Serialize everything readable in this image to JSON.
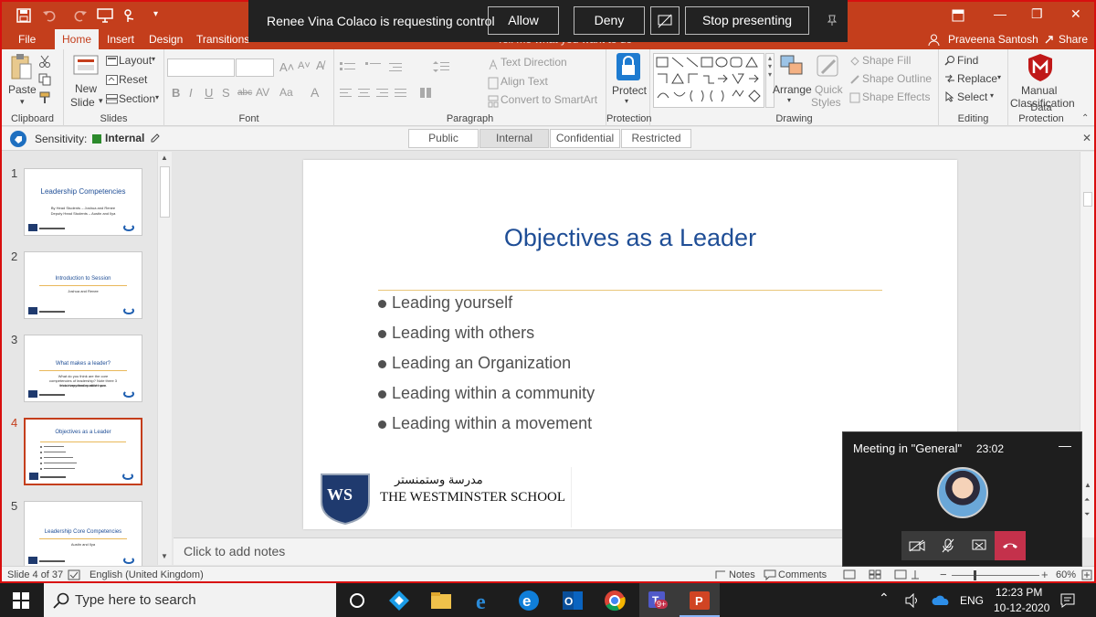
{
  "app": {
    "qat": {
      "save": "save-icon",
      "undo": "undo-icon",
      "redo": "redo-icon",
      "present": "present-icon",
      "touch": "touch-icon",
      "customize": "customize-icon"
    },
    "window_controls": {
      "restore_ribbon": "ribbon-display-icon",
      "minimize": "—",
      "restore": "❐",
      "close": "✕"
    }
  },
  "tabs": [
    "File",
    "Home",
    "Insert",
    "Design",
    "Transitions"
  ],
  "active_tab": "Home",
  "tell_me": "Tell me what you want to do",
  "user": {
    "name": "Praveena Santosh",
    "share": "Share"
  },
  "ribbon": {
    "clipboard": {
      "paste": "Paste",
      "label": "Clipboard"
    },
    "slides": {
      "new_slide_line1": "New",
      "new_slide_line2": "Slide",
      "layout": "Layout",
      "reset": "Reset",
      "section": "Section",
      "label": "Slides"
    },
    "font": {
      "label": "Font",
      "bold": "B",
      "italic": "I",
      "underline": "U",
      "strike": "S",
      "shadow": "abc",
      "spacing": "AV",
      "case": "Aa",
      "color": "A"
    },
    "paragraph": {
      "text_direction": "Text Direction",
      "align_text": "Align Text",
      "smartart": "Convert to SmartArt",
      "label": "Paragraph"
    },
    "protection": {
      "protect": "Protect",
      "label": "Protection"
    },
    "drawing": {
      "arrange": "Arrange",
      "quick_styles_line1": "Quick",
      "quick_styles_line2": "Styles",
      "shape_fill": "Shape Fill",
      "shape_outline": "Shape Outline",
      "shape_effects": "Shape Effects",
      "label": "Drawing"
    },
    "editing": {
      "find": "Find",
      "replace": "Replace",
      "select": "Select",
      "label": "Editing"
    },
    "data_protection": {
      "manual_line1": "Manual",
      "manual_line2": "Classification",
      "label": "Data Protection"
    }
  },
  "sensitivity": {
    "label": "Sensitivity:",
    "value": "Internal",
    "options": [
      "Public",
      "Internal",
      "Confidential",
      "Restricted"
    ],
    "selected": "Internal"
  },
  "thumbnails": [
    {
      "num": "1",
      "title": "Leadership Competencies",
      "sub1": "By Head Students – Joshua and Renee",
      "sub2": "Deputy Head Students – Austin and Ilya"
    },
    {
      "num": "2",
      "title": "Introduction to Session",
      "sub1": "Joshua and Renee",
      "sub2": ""
    },
    {
      "num": "3",
      "title": "What makes a leader?",
      "sub1": "What do you think are the core competencies of leadership? Note three 3 most important qualities you",
      "sub2": "think every leader must have."
    },
    {
      "num": "4",
      "title": "Objectives as a Leader",
      "sub1": "",
      "sub2": ""
    },
    {
      "num": "5",
      "title": "Leadership Core Competencies",
      "sub1": "Austin and Ilya",
      "sub2": ""
    }
  ],
  "slide": {
    "title": "Objectives as a Leader",
    "bullets": [
      "Leading yourself",
      "Leading with others",
      "Leading an Organization",
      "Leading within a community",
      "Leading within a movement"
    ],
    "logo_initials": "WS",
    "logo_arabic": "مدرسة وستمنستر",
    "logo_text": "THE WESTMINSTER SCHOOL"
  },
  "notes_placeholder": "Click to add notes",
  "status": {
    "slide": "Slide 4 of 37",
    "language": "English (United Kingdom)",
    "notes": "Notes",
    "comments": "Comments",
    "zoom": "60%"
  },
  "share_bar": {
    "message": "Renee Vina Colaco is requesting control",
    "allow": "Allow",
    "deny": "Deny",
    "stop": "Stop presenting"
  },
  "meeting": {
    "title": "Meeting in \"General\"",
    "time": "23:02"
  },
  "taskbar": {
    "search_placeholder": "Type here to search",
    "teams_badge": "9+",
    "lang": "ENG",
    "time": "12:23 PM",
    "date": "10-12-2020"
  }
}
